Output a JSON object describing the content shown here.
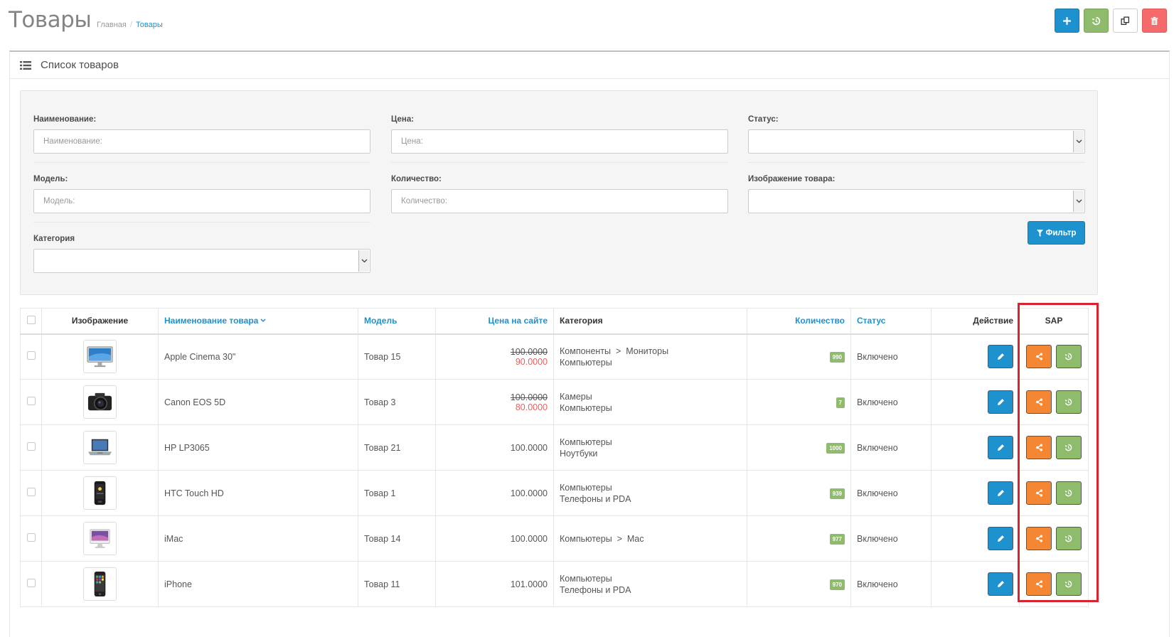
{
  "header": {
    "title": "Товары",
    "breadcrumb": {
      "home": "Главная",
      "current": "Товары"
    }
  },
  "header_buttons": [
    {
      "name": "add-button",
      "icon": "plus-icon",
      "color": "#1e91cf"
    },
    {
      "name": "refresh-button",
      "icon": "history-icon",
      "color": "#8fbb6c"
    },
    {
      "name": "copy-button",
      "icon": "copy-icon",
      "color": "#ffffff"
    },
    {
      "name": "delete-button",
      "icon": "trash-icon",
      "color": "#f56b6b"
    }
  ],
  "panel": {
    "title": "Список товаров",
    "icon": "list-icon"
  },
  "filters": {
    "name_label": "Наименование:",
    "name_placeholder": "Наименование:",
    "name_value": "",
    "price_label": "Цена:",
    "price_placeholder": "Цена:",
    "price_value": "",
    "status_label": "Статус:",
    "status_value": "",
    "model_label": "Модель:",
    "model_placeholder": "Модель:",
    "model_value": "",
    "quantity_label": "Количество:",
    "quantity_placeholder": "Количество:",
    "quantity_value": "",
    "image_label": "Изображение товара:",
    "image_value": "",
    "category_label": "Категория",
    "category_value": "",
    "filter_button": "Фильтр"
  },
  "table": {
    "columns": {
      "image": "Изображение",
      "name": "Наименование товара",
      "model": "Модель",
      "price": "Цена на сайте",
      "category": "Категория",
      "quantity": "Количество",
      "status": "Статус",
      "action": "Действие",
      "sap": "SAP"
    },
    "rows": [
      {
        "image": "monitor",
        "name": "Apple Cinema 30\"",
        "model": "Товар 15",
        "price": "100.0000",
        "special": "90.0000",
        "categories": [
          "Компоненты  >  Мониторы",
          "Компьютеры"
        ],
        "quantity": "990",
        "status": "Включено"
      },
      {
        "image": "camera",
        "name": "Canon EOS 5D",
        "model": "Товар 3",
        "price": "100.0000",
        "special": "80.0000",
        "categories": [
          "Камеры",
          "Компьютеры"
        ],
        "quantity": "7",
        "status": "Включено"
      },
      {
        "image": "laptop",
        "name": "HP LP3065",
        "model": "Товар 21",
        "price": "100.0000",
        "special": "",
        "categories": [
          "Компьютеры",
          "Ноутбуки"
        ],
        "quantity": "1000",
        "status": "Включено"
      },
      {
        "image": "phone-dark",
        "name": "HTC Touch HD",
        "model": "Товар 1",
        "price": "100.0000",
        "special": "",
        "categories": [
          "Компьютеры",
          "Телефоны и PDA"
        ],
        "quantity": "939",
        "status": "Включено"
      },
      {
        "image": "imac",
        "name": "iMac",
        "model": "Товар 14",
        "price": "100.0000",
        "special": "",
        "categories": [
          "Компьютеры  >  Mac"
        ],
        "quantity": "977",
        "status": "Включено"
      },
      {
        "image": "iphone",
        "name": "iPhone",
        "model": "Товар 11",
        "price": "101.0000",
        "special": "",
        "categories": [
          "Компьютеры",
          "Телефоны и PDA"
        ],
        "quantity": "970",
        "status": "Включено"
      }
    ]
  },
  "colors": {
    "primary": "#1e91cf",
    "success": "#8fbb6c",
    "warning": "#f38733",
    "danger": "#f56b6b",
    "highlight_frame": "#d9232e",
    "special_price": "#e06464"
  }
}
